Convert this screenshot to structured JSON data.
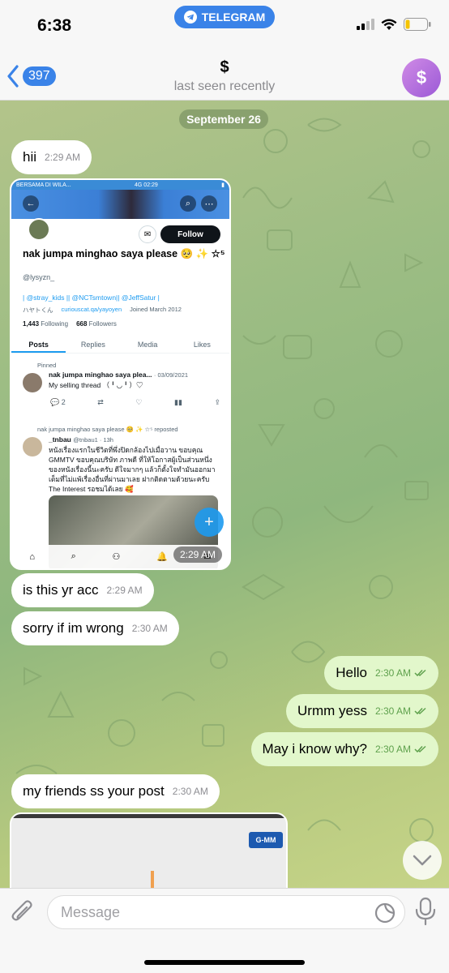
{
  "status_bar": {
    "time": "6:38",
    "app_pill": "TELEGRAM"
  },
  "header": {
    "back_count": "397",
    "title": "$",
    "subtitle": "last seen recently",
    "avatar_letter": "$"
  },
  "chat": {
    "date_label": "September 26",
    "messages": [
      {
        "text": "hii",
        "time": "2:29 AM",
        "side": "in"
      },
      {
        "text": "is this yr acc",
        "time": "2:29 AM",
        "side": "in"
      },
      {
        "text": "sorry if im wrong",
        "time": "2:30 AM",
        "side": "in"
      },
      {
        "text": "Hello",
        "time": "2:30 AM",
        "side": "out"
      },
      {
        "text": "Urmm yess",
        "time": "2:30 AM",
        "side": "out"
      },
      {
        "text": "May i know why?",
        "time": "2:30 AM",
        "side": "out"
      },
      {
        "text": "my friends ss your post",
        "time": "2:30 AM",
        "side": "in"
      }
    ],
    "image_time": "2:29 AM"
  },
  "screenshot": {
    "carrier": "BERSAMA DI WILA...",
    "net": "4G",
    "clock": "02:29",
    "follow_label": "Follow",
    "name": "nak jumpa minghao saya please 🥺 ✨ ☆⁵",
    "handle": "@lysyzn_",
    "links": "| @stray_kids || @NCTsmtown|| @JeffSatur |",
    "meta_name": "ハヤトくん",
    "meta_link": "curiouscat.qa/yayoyen",
    "meta_joined": "Joined March 2012",
    "following_count": "1,443",
    "following_label": "Following",
    "followers_count": "668",
    "followers_label": "Followers",
    "tabs": [
      "Posts",
      "Replies",
      "Media",
      "Likes"
    ],
    "pinned_label": "Pinned",
    "pinned_author": "nak jumpa minghao saya plea...",
    "pinned_date": "· 03/09/2021",
    "pinned_text": "My selling thread （╹◡╹）♡",
    "pinned_replies": "2",
    "repost_label": "nak jumpa minghao saya please 🥺 ✨ ☆⁵ reposted",
    "repost_author": "_tnbau",
    "repost_handle": "@tnbau1 · 13h",
    "repost_text": "หนังเรื่องแรกในชีวิตที่พึ่งปิดกล้องไปเมื่อวาน ขอบคุณ GMMTV ขอบคุณบริษัท ภาพดี ที่ให้โอกาสผู้เป็นส่วนหนึ่งของหนังเรื่องนี้นะครับ ดีใจมากๆ แล้วก็ตั้งใจทำมันออกมาเต็มที่ไม่แพ้เรื่องอื่นที่ผ่านมาเลย ฝากติดตามด้วยนะครับ The Interest รอชมได้เลย 🥰"
  },
  "second_image": {
    "logo": "G-MM"
  },
  "input": {
    "placeholder": "Message"
  },
  "colors": {
    "accent": "#3a83e8",
    "outgoing_bubble": "#e2f7cb",
    "incoming_bubble": "#ffffff"
  }
}
